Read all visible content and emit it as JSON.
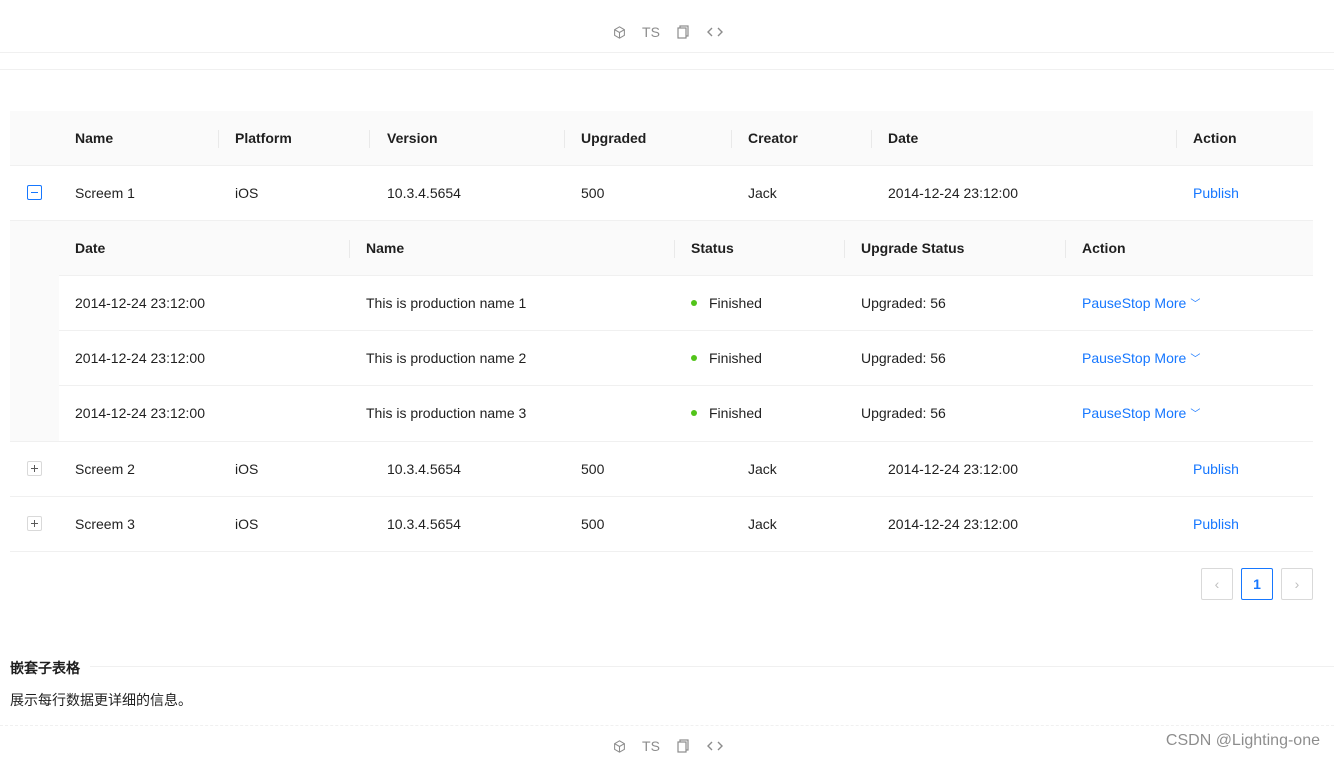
{
  "toolbar": {
    "items": [
      {
        "icon": "codesandbox-icon"
      },
      {
        "label": "TS"
      },
      {
        "icon": "copy-icon"
      },
      {
        "icon": "code-icon"
      }
    ]
  },
  "table": {
    "columns": [
      "Name",
      "Platform",
      "Version",
      "Upgraded",
      "Creator",
      "Date",
      "Action"
    ],
    "rows": [
      {
        "name": "Screem 1",
        "platform": "iOS",
        "version": "10.3.4.5654",
        "upgraded": "500",
        "creator": "Jack",
        "date": "2014-12-24 23:12:00",
        "action": "Publish",
        "expanded": true
      },
      {
        "name": "Screem 2",
        "platform": "iOS",
        "version": "10.3.4.5654",
        "upgraded": "500",
        "creator": "Jack",
        "date": "2014-12-24 23:12:00",
        "action": "Publish",
        "expanded": false
      },
      {
        "name": "Screem 3",
        "platform": "iOS",
        "version": "10.3.4.5654",
        "upgraded": "500",
        "creator": "Jack",
        "date": "2014-12-24 23:12:00",
        "action": "Publish",
        "expanded": false
      }
    ]
  },
  "nested": {
    "columns": [
      "Date",
      "Name",
      "Status",
      "Upgrade Status",
      "Action"
    ],
    "rows": [
      {
        "date": "2014-12-24 23:12:00",
        "name": "This is production name 1",
        "status": "Finished",
        "upgrade": "Upgraded: 56",
        "pause": "Pause",
        "stop": "Stop",
        "more": "More"
      },
      {
        "date": "2014-12-24 23:12:00",
        "name": "This is production name 2",
        "status": "Finished",
        "upgrade": "Upgraded: 56",
        "pause": "Pause",
        "stop": "Stop",
        "more": "More"
      },
      {
        "date": "2014-12-24 23:12:00",
        "name": "This is production name 3",
        "status": "Finished",
        "upgrade": "Upgraded: 56",
        "pause": "Pause",
        "stop": "Stop",
        "more": "More"
      }
    ],
    "status_color": "#52c41a"
  },
  "pagination": {
    "prev": "‹",
    "current": "1",
    "next": "›"
  },
  "section": {
    "title": "嵌套子表格",
    "description": "展示每行数据更详细的信息。"
  },
  "watermark": "CSDN @Lighting-one",
  "colors": {
    "primary": "#1677ff",
    "header_bg": "#fafafa",
    "border": "#f0f0f0"
  }
}
